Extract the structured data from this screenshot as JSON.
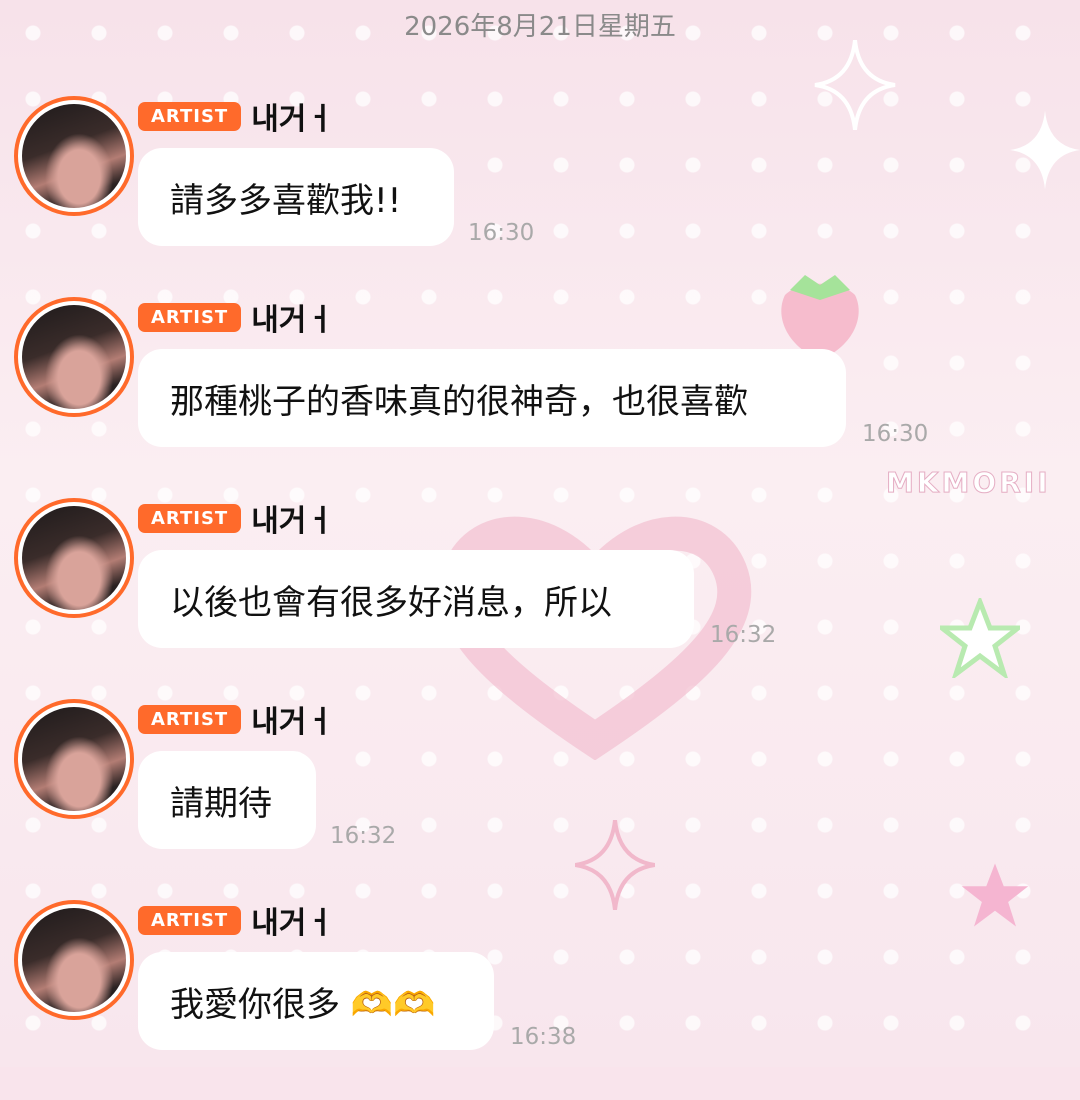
{
  "date_header": "2026年8月21日星期五",
  "watermark": "MKMORII",
  "messages": [
    {
      "badge": "ARTIST",
      "sender": "내거ㅓ",
      "text": "請多多喜歡我!!",
      "time": "16:30"
    },
    {
      "badge": "ARTIST",
      "sender": "내거ㅓ",
      "text": "那種桃子的香味真的很神奇，也很喜歡",
      "time": "16:30"
    },
    {
      "badge": "ARTIST",
      "sender": "내거ㅓ",
      "text": "以後也會有很多好消息，所以",
      "time": "16:32"
    },
    {
      "badge": "ARTIST",
      "sender": "내거ㅓ",
      "text": "請期待",
      "time": "16:32"
    },
    {
      "badge": "ARTIST",
      "sender": "내거ㅓ",
      "text": "我愛你很多 🫶🫶",
      "time": "16:38"
    }
  ],
  "colors": {
    "badge": "#ff6a2b",
    "bubble": "#ffffff",
    "time": "#a9a9a9"
  }
}
